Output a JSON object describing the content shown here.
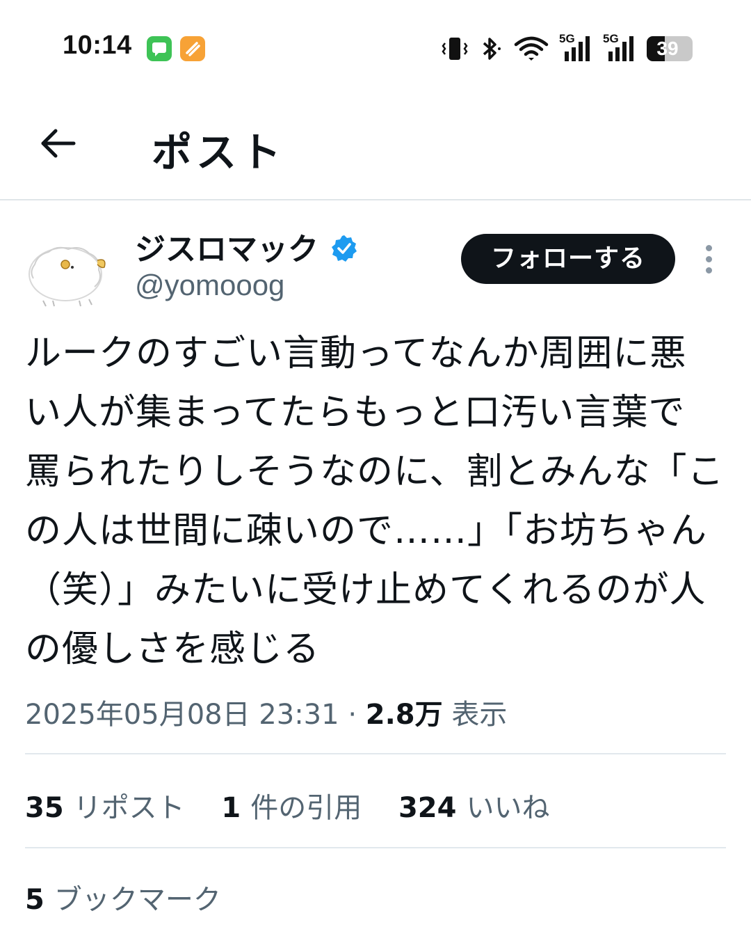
{
  "status_bar": {
    "time": "10:14",
    "network_1": "5G",
    "network_2": "5G",
    "battery_level": "39",
    "icons": [
      "messages-app-icon",
      "notes-app-icon",
      "vibrate-icon",
      "bluetooth-icon",
      "wifi-icon",
      "signal-icon",
      "signal-icon",
      "battery-icon"
    ]
  },
  "header": {
    "back_icon": "arrow-left-icon",
    "title": "ポスト"
  },
  "author": {
    "display_name": "ジスロマック",
    "handle": "@yomooog",
    "verified_color": "#1d9bf0",
    "follow_label": "フォローする",
    "more_icon": "more-vertical-icon"
  },
  "tweet": {
    "lines": [
      "ルークのすごい言動ってなんか周囲に悪",
      "い人が集まってたらもっと口汚い言葉で",
      "罵られたりしそうなのに、割とみんな「こ",
      "の人は世間に疎いので……」「お坊ちゃん",
      "（笑）」みたいに受け止めてくれるのが人",
      "の優しさを感じる"
    ],
    "timestamp": "2025年05月08日 23:31",
    "separator": "·",
    "views_count": "2.8万",
    "views_label": "表示"
  },
  "stats": {
    "reposts_count": "35",
    "reposts_label": "リポスト",
    "quotes_count": "1",
    "quotes_label": "件の引用",
    "likes_count": "324",
    "likes_label": "いいね",
    "bookmarks_count": "5",
    "bookmarks_label": "ブックマーク"
  },
  "colors": {
    "text_primary": "#0f1419",
    "text_secondary": "#536471",
    "divider": "#e1e8ed",
    "follow_bg": "#0f1419",
    "verified": "#1d9bf0"
  }
}
